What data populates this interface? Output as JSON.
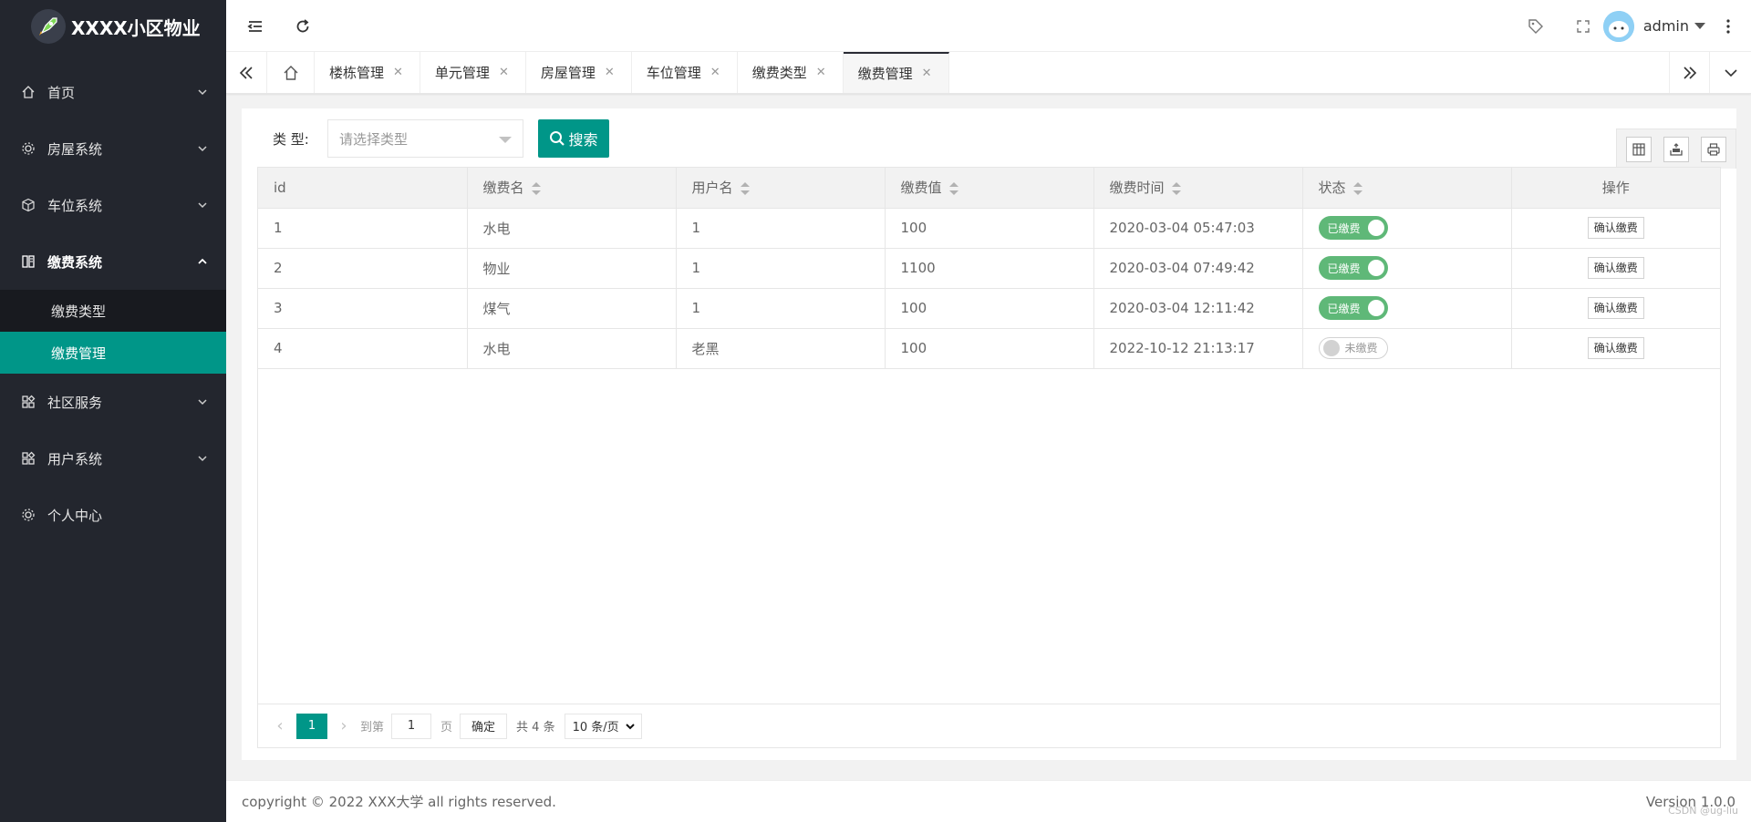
{
  "app": {
    "title": "XXXX小区物业"
  },
  "sidebar": {
    "items": [
      {
        "label": "首页",
        "icon": "home-icon"
      },
      {
        "label": "房屋系统",
        "icon": "gear-icon"
      },
      {
        "label": "车位系统",
        "icon": "cube-icon"
      },
      {
        "label": "缴费系统",
        "icon": "book-icon"
      },
      {
        "label": "社区服务",
        "icon": "apps-icon"
      },
      {
        "label": "用户系统",
        "icon": "apps-icon"
      },
      {
        "label": "个人中心",
        "icon": "gear-icon"
      }
    ],
    "submenu": [
      {
        "label": "缴费类型"
      },
      {
        "label": "缴费管理"
      }
    ]
  },
  "header": {
    "user_name": "admin"
  },
  "tabs": [
    {
      "label": "楼栋管理"
    },
    {
      "label": "单元管理"
    },
    {
      "label": "房屋管理"
    },
    {
      "label": "车位管理"
    },
    {
      "label": "缴费类型"
    },
    {
      "label": "缴费管理"
    }
  ],
  "search": {
    "label": "类 型:",
    "placeholder": "请选择类型",
    "button": "搜索"
  },
  "table": {
    "columns": [
      "id",
      "缴费名",
      "用户名",
      "缴费值",
      "缴费时间",
      "状态",
      "操作"
    ],
    "rows": [
      {
        "id": "1",
        "name": "水电",
        "user": "1",
        "value": "100",
        "time": "2020-03-04 05:47:03",
        "status": "已缴费",
        "action": "确认缴费"
      },
      {
        "id": "2",
        "name": "物业",
        "user": "1",
        "value": "1100",
        "time": "2020-03-04 07:49:42",
        "status": "已缴费",
        "action": "确认缴费"
      },
      {
        "id": "3",
        "name": "煤气",
        "user": "1",
        "value": "100",
        "time": "2020-03-04 12:11:42",
        "status": "已缴费",
        "action": "确认缴费"
      },
      {
        "id": "4",
        "name": "水电",
        "user": "老黑",
        "value": "100",
        "time": "2022-10-12 21:13:17",
        "status": "未缴费",
        "action": "确认缴费"
      }
    ]
  },
  "pager": {
    "current": "1",
    "goto_label": "到第",
    "goto_value": "1",
    "page_label": "页",
    "confirm": "确定",
    "total": "共 4 条",
    "page_size": "10 条/页"
  },
  "footer": {
    "copyright": "copyright © 2022 XXX大学 all rights reserved.",
    "version": "Version 1.0.0",
    "watermark": "CSDN @ug-liu"
  },
  "colors": {
    "sidebar_bg": "#23262e",
    "accent": "#009688",
    "switch_on": "#5FB878"
  }
}
